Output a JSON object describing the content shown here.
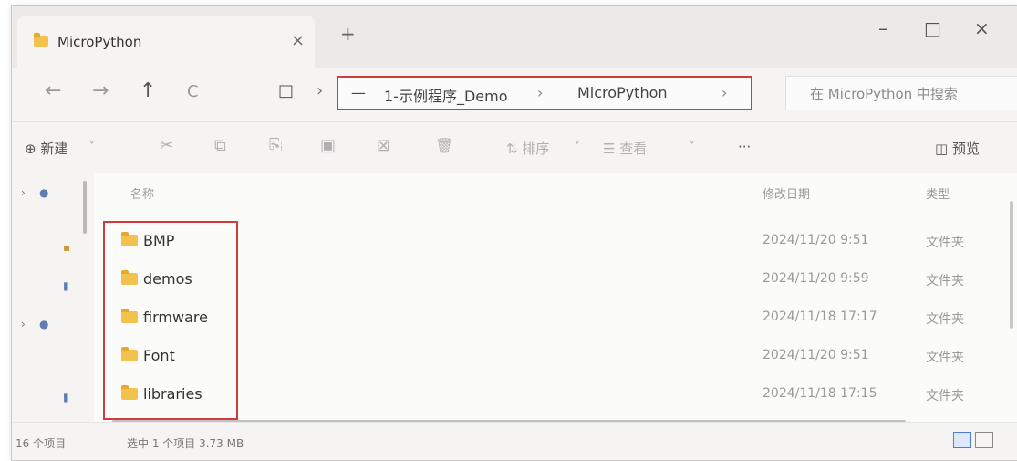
{
  "tab": {
    "title": "MicroPython",
    "close": "×",
    "add": "+"
  },
  "window_controls": {
    "minimize": "–",
    "maximize": "□",
    "close": "×"
  },
  "nav": {
    "back": "←",
    "forward": "→",
    "up": "↑",
    "refresh": "C",
    "pc": "□",
    "sep": "›"
  },
  "address": {
    "root_sep": "—",
    "crumb1": "1-示例程序_Demo",
    "arrow1": "›",
    "crumb2": "MicroPython",
    "arrow2": "›"
  },
  "search": {
    "placeholder": "在 MicroPython 中搜索"
  },
  "commands": {
    "new": "⊕ 新建",
    "new_dd": "˅",
    "cut": "✂",
    "copy": "⧉",
    "paste": "⎘",
    "rename": "▣",
    "share": "⊠",
    "delete": "🗑",
    "sort": "⇅ 排序",
    "sort_dd": "˅",
    "view": "☰ 查看",
    "view_dd": "˅",
    "more": "···",
    "preview": "◫ 预览"
  },
  "columns": {
    "name": "名称",
    "modified": "修改日期",
    "type": "类型"
  },
  "files": [
    {
      "name": "BMP",
      "date": "2024/11/20 9:51",
      "type": "文件夹"
    },
    {
      "name": "demos",
      "date": "2024/11/20 9:59",
      "type": "文件夹"
    },
    {
      "name": "firmware",
      "date": "2024/11/18 17:17",
      "type": "文件夹"
    },
    {
      "name": "Font",
      "date": "2024/11/20 9:51",
      "type": "文件夹"
    },
    {
      "name": "libraries",
      "date": "2024/11/18 17:15",
      "type": "文件夹"
    }
  ],
  "status": {
    "count": "16 个项目",
    "selected": "选中 1 个项目 3.73 MB"
  },
  "colors": {
    "highlight": "#d23b3b",
    "folder": "#f3c24c"
  }
}
